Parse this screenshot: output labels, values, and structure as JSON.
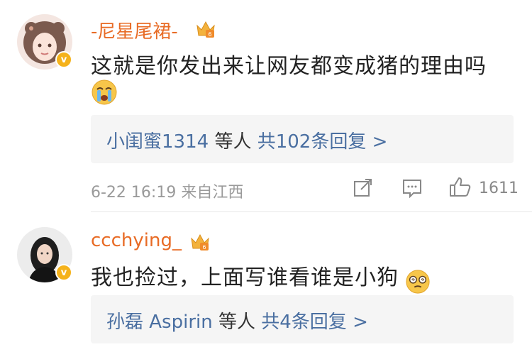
{
  "comments": [
    {
      "username": "-尼星尾裙-",
      "text": "这就是你发出来让网友都变成猪的理由吗",
      "emoji": "crying-emoji",
      "reply": {
        "users": "小闺蜜1314",
        "suffix": "等人",
        "count": "共102条回复 >"
      },
      "date": "6-22 16:19",
      "location": "来自江西",
      "likes": "1611"
    },
    {
      "username": "ccchying_",
      "text": "我也捡过，上面写谁看谁是小狗",
      "emoji": "dizzy-emoji",
      "reply": {
        "users": "孙磊 Aspirin",
        "suffix": "等人",
        "count": "共4条回复 >"
      }
    }
  ],
  "colors": {
    "username": "#e86b25",
    "link": "#4a6fa1",
    "meta": "#9a9a9a",
    "badge": "#f5b21a"
  }
}
